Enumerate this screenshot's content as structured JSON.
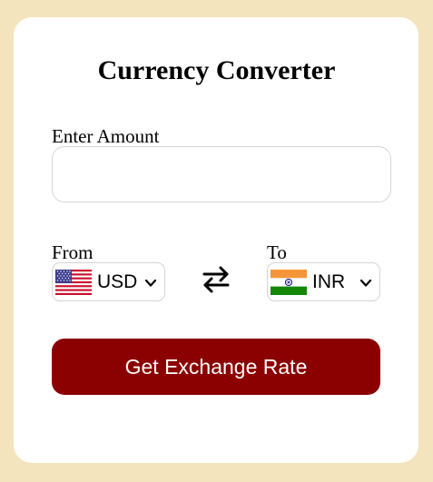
{
  "title": "Currency Converter",
  "amount": {
    "label": "Enter Amount",
    "value": "",
    "placeholder": ""
  },
  "from": {
    "label": "From",
    "currency": "USD",
    "flag": "us-flag-icon"
  },
  "to": {
    "label": "To",
    "currency": "INR",
    "flag": "india-flag-icon"
  },
  "swap_icon": "swap-arrows-icon",
  "button": {
    "label": "Get Exchange Rate"
  },
  "colors": {
    "page_background": "#f3e4bd",
    "card_background": "#ffffff",
    "button_background": "#8b0000",
    "button_text": "#ffffff",
    "border": "#d4d4d4"
  }
}
